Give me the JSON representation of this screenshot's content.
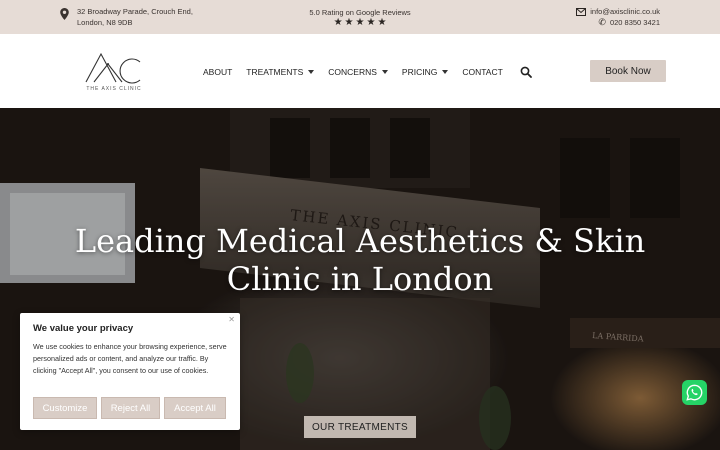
{
  "topbar": {
    "address_line1": "32 Broadway Parade, Crouch End,",
    "address_line2": "London, N8 9DB",
    "rating_text": "5.0 Rating on Google Reviews",
    "rating_value": 5,
    "email": "info@axisclinic.co.uk",
    "phone": "020 8350 3421"
  },
  "header": {
    "logo_text": "THE AXIS CLINIC",
    "nav": [
      {
        "label": "ABOUT",
        "dropdown": false
      },
      {
        "label": "TREATMENTS",
        "dropdown": true
      },
      {
        "label": "CONCERNS",
        "dropdown": true
      },
      {
        "label": "PRICING",
        "dropdown": true
      },
      {
        "label": "CONTACT",
        "dropdown": false
      }
    ],
    "book_label": "Book Now"
  },
  "hero": {
    "title_line1": "Leading Medical Aesthetics & Skin",
    "title_line2": "Clinic in London",
    "sign_text": "THE AXIS CLINIC",
    "cta_label": "OUR TREATMENTS"
  },
  "cookie": {
    "title": "We value your privacy",
    "body": "We use cookies to enhance your browsing experience, serve personalized ads or content, and analyze our traffic. By clicking \"Accept All\", you consent to our use of cookies.",
    "customize": "Customize",
    "reject": "Reject All",
    "accept": "Accept All"
  },
  "colors": {
    "topbar_bg": "#e6dcd6",
    "button_bg": "#d8cdc6",
    "whatsapp": "#25d366"
  }
}
